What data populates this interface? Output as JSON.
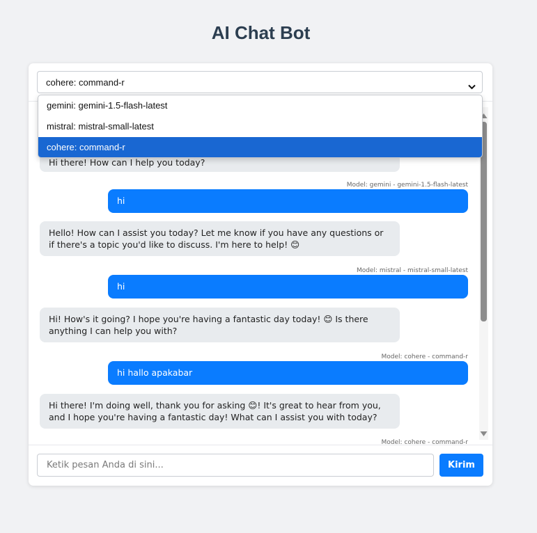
{
  "title": "AI Chat Bot",
  "model_select": {
    "value": "cohere: command-r",
    "options": [
      {
        "label": "gemini: gemini-1.5-flash-latest",
        "selected": false
      },
      {
        "label": "mistral: mistral-small-latest",
        "selected": false
      },
      {
        "label": "cohere: command-r",
        "selected": true
      }
    ]
  },
  "messages": [
    {
      "role": "bot",
      "text": "Hi there! How can I help you today?"
    },
    {
      "role": "user",
      "model": "Model: gemini - gemini-1.5-flash-latest",
      "text": "hi"
    },
    {
      "role": "bot",
      "text": "Hello! How can I assist you today? Let me know if you have any questions or if there's a topic you'd like to discuss. I'm here to help! 😊"
    },
    {
      "role": "user",
      "model": "Model: mistral - mistral-small-latest",
      "text": "hi"
    },
    {
      "role": "bot",
      "text": "Hi! How's it going? I hope you're having a fantastic day today! 😊 Is there anything I can help you with?"
    },
    {
      "role": "user",
      "model": "Model: cohere - command-r",
      "text": "hi hallo apakabar"
    },
    {
      "role": "bot",
      "text": "Hi there! I'm doing well, thank you for asking 😊! It's great to hear from you, and I hope you're having a fantastic day! What can I assist you with today?"
    },
    {
      "role": "user",
      "model": "Model: cohere - command-r",
      "text": ""
    }
  ],
  "input": {
    "placeholder": "Ketik pesan Anda di sini...",
    "value": ""
  },
  "send_label": "Kirim",
  "colors": {
    "accent": "#0a7cff",
    "bot_bubble": "#e8ebee",
    "selected_option": "#1967d2"
  }
}
